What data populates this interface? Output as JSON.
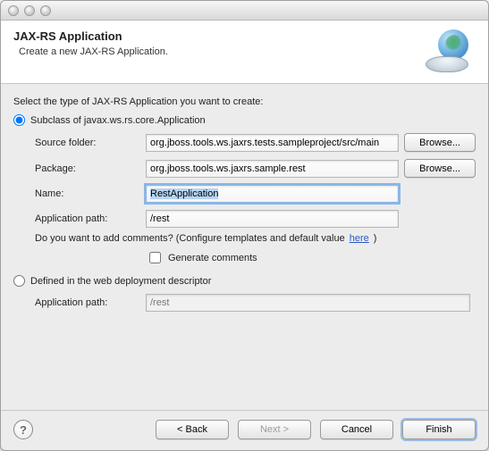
{
  "banner": {
    "title": "JAX-RS Application",
    "subtitle": "Create a new JAX-RS Application.",
    "icon": "globe-dish-icon"
  },
  "instruction": "Select the type of JAX-RS Application you want to create:",
  "option_subclass": {
    "label": "Subclass of javax.ws.rs.core.Application",
    "selected": true,
    "source_folder": {
      "label": "Source folder:",
      "value": "org.jboss.tools.ws.jaxrs.tests.sampleproject/src/main",
      "browse": "Browse..."
    },
    "package": {
      "label": "Package:",
      "value": "org.jboss.tools.ws.jaxrs.sample.rest",
      "browse": "Browse..."
    },
    "name": {
      "label": "Name:",
      "value": "RestApplication",
      "focused": true,
      "text_selected": true
    },
    "app_path": {
      "label": "Application path:",
      "value": "/rest"
    },
    "comments": {
      "question_prefix": "Do you want to add comments? (Configure templates and default value ",
      "link_text": "here",
      "question_suffix": ")",
      "generate_label": "Generate comments",
      "generate_checked": false
    }
  },
  "option_descriptor": {
    "label": "Defined in the web deployment descriptor",
    "selected": false,
    "app_path": {
      "label": "Application path:",
      "value": "/rest",
      "enabled": false
    }
  },
  "buttons": {
    "help": "?",
    "back": "< Back",
    "next": "Next >",
    "next_enabled": false,
    "cancel": "Cancel",
    "finish": "Finish",
    "default": "finish"
  }
}
